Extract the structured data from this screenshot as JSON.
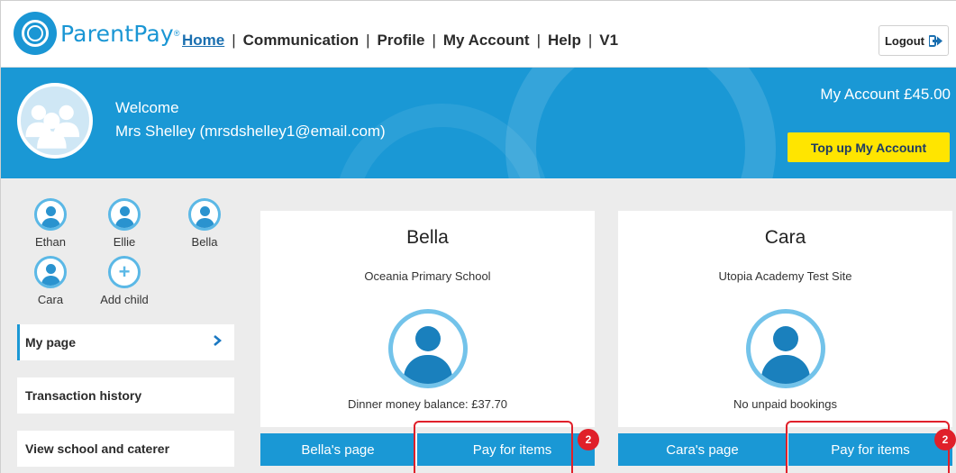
{
  "brand": {
    "name": "ParentPay",
    "reg": "®"
  },
  "nav": {
    "items": [
      {
        "label": "Home",
        "active": true
      },
      {
        "label": "Communication"
      },
      {
        "label": "Profile"
      },
      {
        "label": "My Account"
      },
      {
        "label": "Help"
      },
      {
        "label": "V1"
      }
    ],
    "separator": "|"
  },
  "logout": {
    "label": "Logout"
  },
  "header": {
    "welcome": "Welcome",
    "user": "Mrs Shelley (mrsdshelley1@email.com)",
    "account": "My Account £45.00",
    "topup_label": "Top up My Account"
  },
  "children": [
    {
      "name": "Ethan"
    },
    {
      "name": "Ellie"
    },
    {
      "name": "Bella"
    },
    {
      "name": "Cara"
    }
  ],
  "add_child": {
    "label": "Add child"
  },
  "sidebar": {
    "items": [
      {
        "label": "My page",
        "active": true
      },
      {
        "label": "Transaction history"
      },
      {
        "label": "View school and caterer"
      }
    ]
  },
  "cards": [
    {
      "name": "Bella",
      "school": "Oceania Primary School",
      "status": "Dinner money balance: £37.70",
      "page_button": "Bella's page",
      "pay_button": "Pay for items",
      "badge": "2"
    },
    {
      "name": "Cara",
      "school": "Utopia Academy Test Site",
      "status": "No unpaid bookings",
      "page_button": "Cara's page",
      "pay_button": "Pay for items",
      "badge": "2"
    }
  ],
  "colors": {
    "brand_blue": "#1a98d5",
    "topup_yellow": "#ffe500",
    "highlight_red": "#e0202a"
  }
}
